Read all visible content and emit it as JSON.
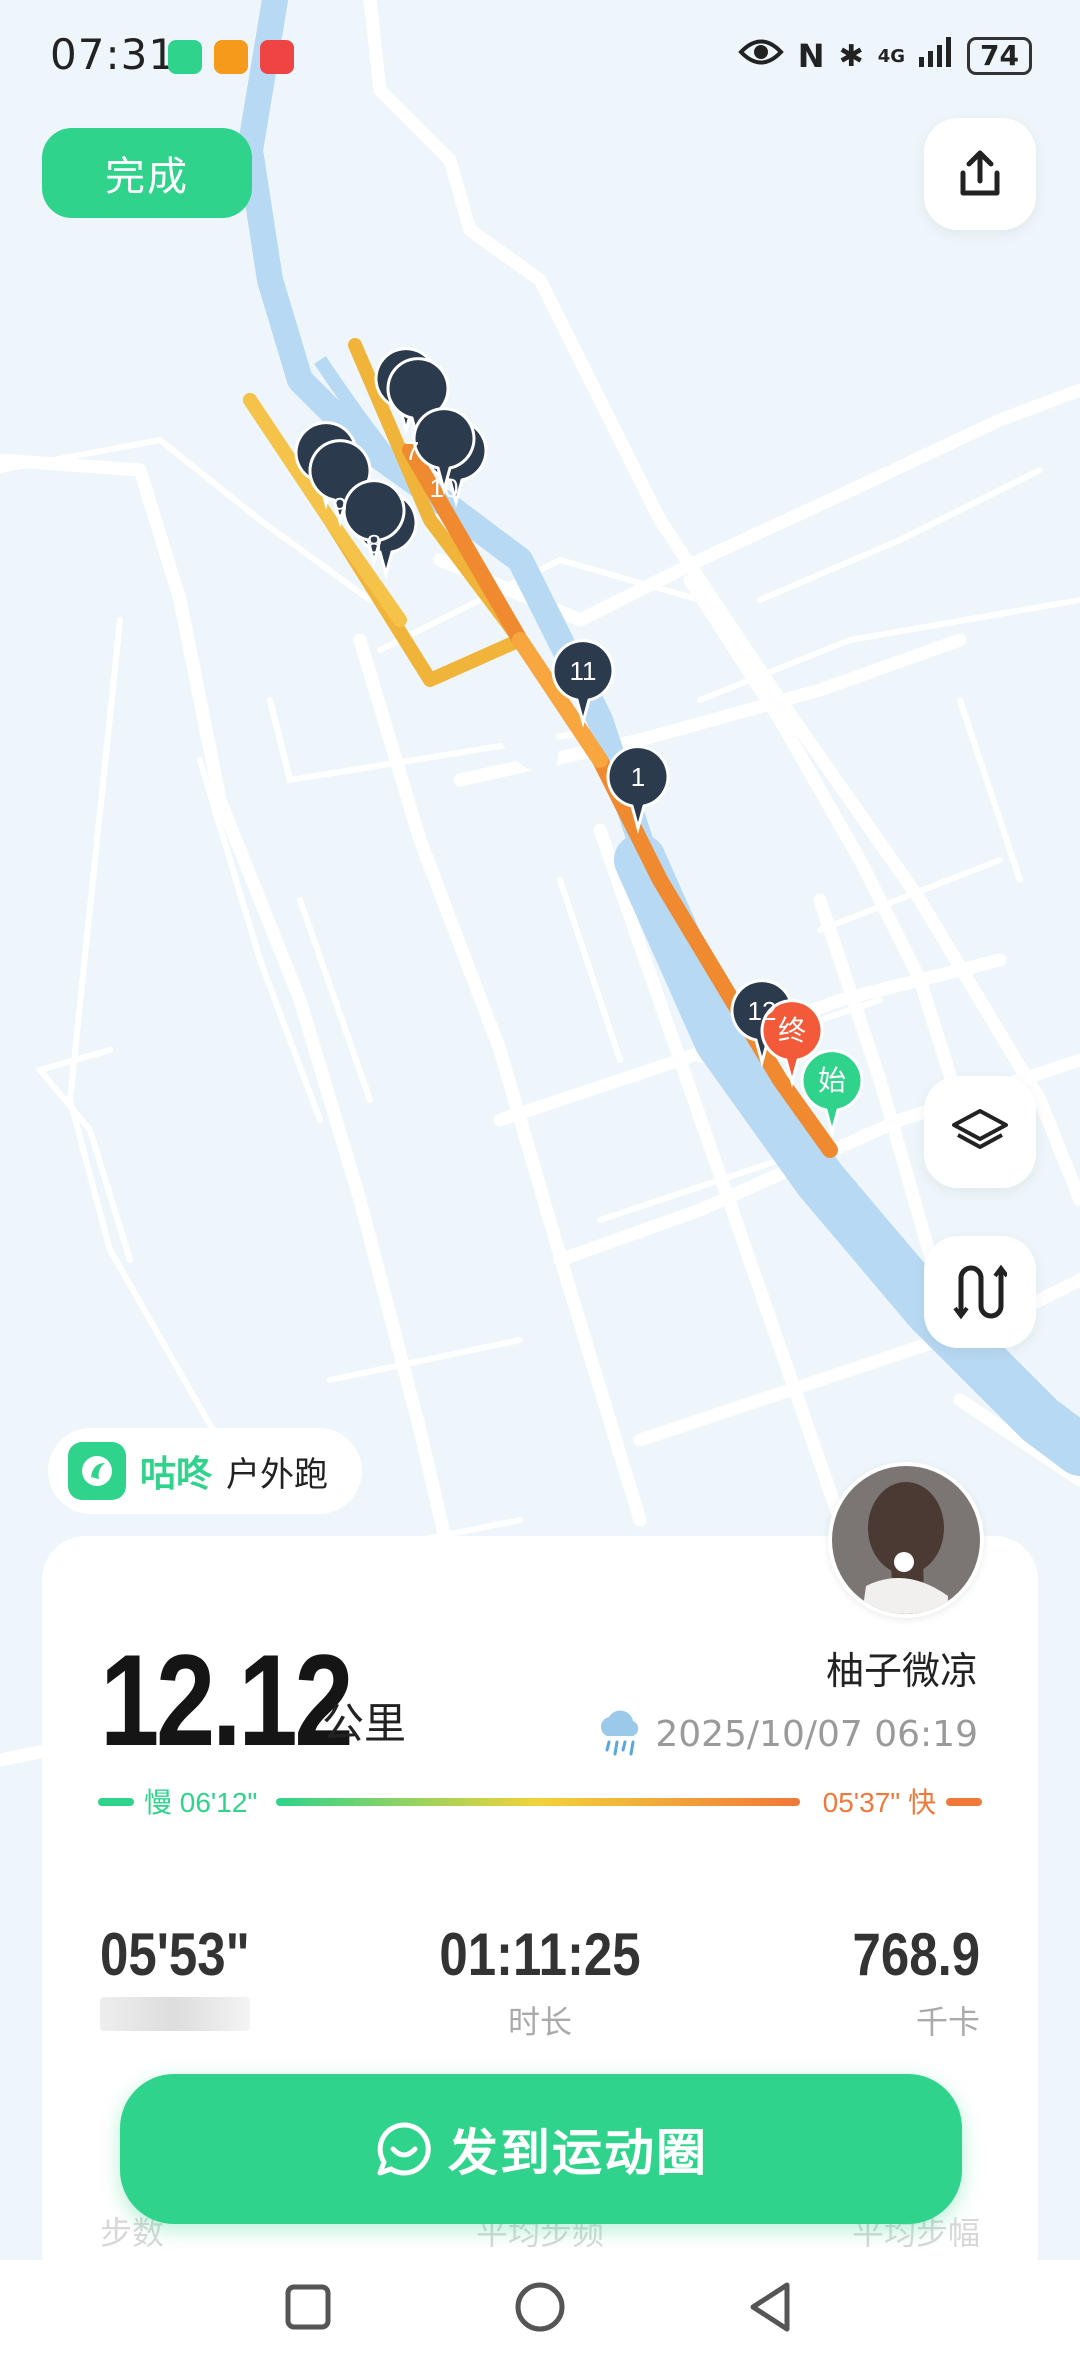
{
  "status_bar": {
    "time": "07:31",
    "battery": "74",
    "network": "4G"
  },
  "header": {
    "done_label": "完成"
  },
  "map": {
    "markers": [
      "7",
      "10",
      "9",
      "8",
      "11",
      "1",
      "12"
    ],
    "end_label": "终",
    "start_label": "始"
  },
  "brand": {
    "app_name": "咕咚",
    "activity_type": "户外跑"
  },
  "summary": {
    "distance": "12.12",
    "distance_unit": "公里",
    "username": "柚子微凉",
    "datetime": "2025/10/07 06:19",
    "pace_slow": "慢 06'12\"",
    "pace_fast": "05'37\" 快"
  },
  "stats": {
    "pace": {
      "value": "05'53\""
    },
    "duration": {
      "value": "01:11:25",
      "label": "时长"
    },
    "calories": {
      "value": "768.9",
      "label": "千卡"
    },
    "hidden_labels": [
      "步数",
      "平均步频",
      "平均步幅"
    ]
  },
  "post_button": {
    "label": "发到运动圈"
  },
  "colors": {
    "accent": "#2fd38b",
    "route": "#f0b43a",
    "route_fast": "#f08a30",
    "end_marker": "#f25a3a",
    "marker": "#2c3a4e"
  }
}
